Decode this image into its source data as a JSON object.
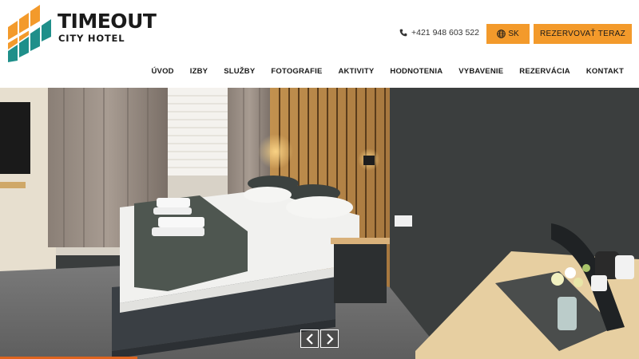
{
  "brand": {
    "name": "TIMEOUT",
    "subtitle": "CITY HOTEL"
  },
  "header": {
    "phone": "+421 948 603 522",
    "language_label": "SK",
    "book_label": "REZERVOVAŤ TERAZ"
  },
  "nav": {
    "items": [
      {
        "label": "ÚVOD"
      },
      {
        "label": "IZBY"
      },
      {
        "label": "SLUŽBY"
      },
      {
        "label": "FOTOGRAFIE"
      },
      {
        "label": "AKTIVITY"
      },
      {
        "label": "HODNOTENIA"
      },
      {
        "label": "VYBAVENIE"
      },
      {
        "label": "REZERVÁCIA"
      },
      {
        "label": "KONTAKT"
      }
    ]
  },
  "slider": {
    "prev_glyph": "‹",
    "next_glyph": "›"
  },
  "colors": {
    "accent_orange": "#f39a2b",
    "logo_teal": "#1f8f8a",
    "progress": "#e0641e"
  },
  "icons": [
    "phone-icon",
    "globe-icon",
    "chevron-left-icon",
    "chevron-right-icon"
  ]
}
